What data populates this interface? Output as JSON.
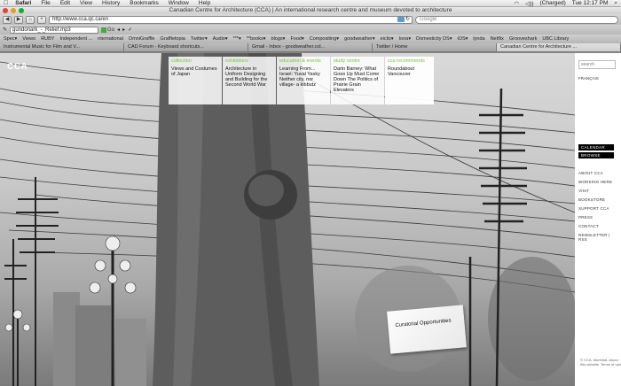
{
  "menubar": {
    "app": "Safari",
    "items": [
      "File",
      "Edit",
      "View",
      "History",
      "Bookmarks",
      "Window",
      "Help"
    ],
    "status": {
      "battery": "(Charged)",
      "day_time": "Tue 12:17 PM"
    }
  },
  "window": {
    "title": "Canadian Centre for Architecture (CCA) | An international research centre and museum devoted to architecture"
  },
  "toolbar": {
    "url": "http://www.cca.qc.ca/en",
    "search_placeholder": "Google",
    "mini_input": "gundonark_-_Relief.mp3",
    "go_label": "Go"
  },
  "bookmarks": [
    "Spec▾",
    "Viewo",
    "RUBY",
    "Independent ...",
    "nternational",
    "OmniGraffle",
    "Graffletopia",
    "Twitter▾",
    "Audio▾",
    "***▾",
    "**books▾",
    "blogs▾",
    "Food▾",
    "Compositing▾",
    "goodweather▾",
    "eiclis▾",
    "Iona▾",
    "Domesticity DS▾",
    "iOS▾",
    "lynda",
    "Netflix",
    "Grooveshark",
    "UBC Library"
  ],
  "tabs": [
    {
      "label": "Instrumental Music for Film and V...",
      "active": false
    },
    {
      "label": "CAD Forum - Keyboard shortcuts...",
      "active": false
    },
    {
      "label": "Gmail - Inbox - goodweather.col...",
      "active": false
    },
    {
      "label": "Twitter / Home",
      "active": false
    },
    {
      "label": "Canadian Centre for Architecture ...",
      "active": true
    }
  ],
  "site": {
    "logo": "CCA",
    "menu": [
      {
        "heading": "collection",
        "text": "Views and Costumes of Japan"
      },
      {
        "heading": "exhibitions",
        "text": "Architecture in Uniform Designing and Building for the Second World War"
      },
      {
        "heading": "education & events",
        "text": "Learning From... Israel: Yuval Yasky Neither city, nor village- a kibbutz"
      },
      {
        "heading": "study centre",
        "text": "Darin Barney: What Goes Up Must Come Down The Politics of Prairie Grain Elevators"
      },
      {
        "heading": "cca recommends",
        "text": "Roundabout Vancouver"
      }
    ],
    "sidebar": {
      "search_placeholder": "search",
      "language": "FRANÇAIS",
      "buttons": [
        "CALENDAR",
        "BROWSE"
      ],
      "links": [
        "ABOUT CCA",
        "WORKING HERE",
        "VISIT",
        "BOOKSTORE",
        "SUPPORT CCA",
        "PRESS",
        "CONTACT",
        "NEWSLETTER | RSS"
      ],
      "footnote": "© CCA, Montréal. About this website. Terms of use"
    },
    "card": "Curatorial Opportunities"
  },
  "colors": {
    "accent_green": "#7ac142",
    "button_black": "#000000"
  }
}
